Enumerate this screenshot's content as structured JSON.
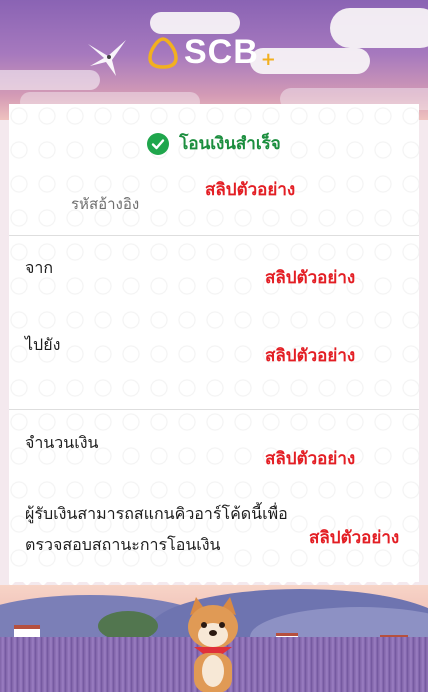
{
  "brand": {
    "name": "SCB",
    "plus": "+"
  },
  "transfer": {
    "title": "โอนเงินสำเร็จ",
    "reference_label": "รหัสอ้างอิง",
    "reference_value": "สลิปตัวอย่าง",
    "from_label": "จาก",
    "from_value": "สลิปตัวอย่าง",
    "to_label": "ไปยัง",
    "to_value": "สลิปตัวอย่าง",
    "amount_label": "จำนวนเงิน",
    "amount_value": "สลิปตัวอย่าง",
    "notice_line1": "ผู้รับเงินสามารถสแกนคิวอาร์โค้ดนี้เพื่อ",
    "notice_line2": "ตรวจสอบสถานะการโอนเงิน",
    "notice_value": "สลิปตัวอย่าง"
  },
  "colors": {
    "success": "#1fa64c",
    "sample_red": "#e31e24",
    "logo_gold": "#f2b01f"
  }
}
